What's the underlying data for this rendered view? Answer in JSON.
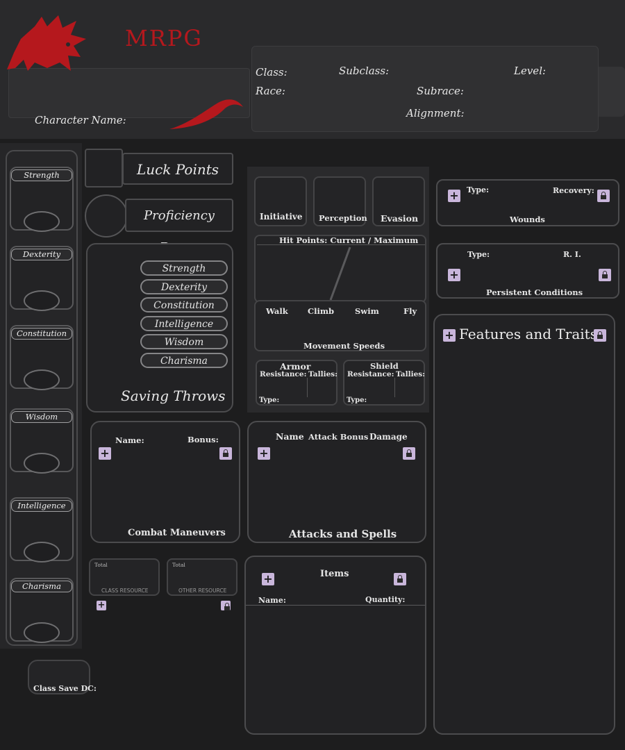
{
  "header": {
    "logo_text": "MRPG",
    "character_name_label": "Character Name:",
    "class_label": "Class:",
    "subclass_label": "Subclass:",
    "level_label": "Level:",
    "race_label": "Race:",
    "subrace_label": "Subrace:",
    "alignment_label": "Alignment:"
  },
  "abilities": [
    {
      "label": "Strength"
    },
    {
      "label": "Dexterity"
    },
    {
      "label": "Constitution"
    },
    {
      "label": "Wisdom"
    },
    {
      "label": "Intelligence"
    },
    {
      "label": "Charisma"
    }
  ],
  "luck_points_label": "Luck Points",
  "proficiency_bonus_label": "Proficiency Bonus",
  "saving_throws": {
    "title": "Saving Throws",
    "items": [
      "Strength",
      "Dexterity",
      "Constitution",
      "Intelligence",
      "Wisdom",
      "Charisma"
    ]
  },
  "combat": {
    "initiative": "Initiative",
    "perception": "Perception",
    "evasion": "Evasion",
    "hit_points": "Hit Points: Current / Maximum",
    "walk": "Walk",
    "climb": "Climb",
    "swim": "Swim",
    "fly": "Fly",
    "movement_speeds": "Movement Speeds",
    "armor": {
      "title": "Armor",
      "resistance": "Resistance:",
      "tallies": "Tallies:",
      "type": "Type:"
    },
    "shield": {
      "title": "Shield",
      "resistance": "Resistance:",
      "tallies": "Tallies:",
      "type": "Type:"
    }
  },
  "wounds": {
    "type_label": "Type:",
    "recovery_label": "Recovery:",
    "title": "Wounds"
  },
  "conditions": {
    "type_label": "Type:",
    "ri_label": "R. I.",
    "title": "Persistent Conditions"
  },
  "features_title": "Features and Traits",
  "maneuvers": {
    "name_label": "Name:",
    "bonus_label": "Bonus:",
    "title": "Combat Maneuvers"
  },
  "attacks": {
    "name_col": "Name",
    "attack_col": "Attack Bonus",
    "damage_col": "Damage",
    "title": "Attacks and Spells"
  },
  "resources": {
    "class": {
      "total": "Total",
      "label": "CLASS RESOURCE"
    },
    "other": {
      "total": "Total",
      "label": "OTHER RESOURCE"
    }
  },
  "items": {
    "title": "Items",
    "name_label": "Name:",
    "quantity_label": "Quantity:"
  },
  "class_save_dc_label": "Class Save DC:",
  "icons": {
    "add": "+",
    "lock": "lock-icon",
    "logo": "dragon-icon"
  },
  "colors": {
    "accent_red": "#b5181d",
    "button": "#c9b6db",
    "background": "#1d1d1e"
  }
}
